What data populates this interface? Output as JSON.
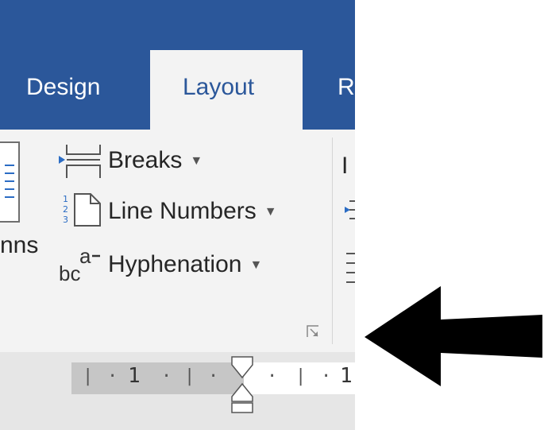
{
  "tabs": {
    "design": "Design",
    "layout": "Layout",
    "next_partial": "R"
  },
  "ribbon": {
    "columns_partial": "nns",
    "breaks": "Breaks",
    "line_numbers": "Line Numbers",
    "hyphenation": "Hyphenation",
    "indent_partial": "I",
    "dropdown_caret": "▼"
  },
  "ruler": {
    "mark_left": "1",
    "mark_right": "1"
  },
  "colors": {
    "tabbar": "#2b579a",
    "ribbon": "#f3f3f3",
    "arrow": "#000000"
  },
  "icons": [
    "breaks-icon",
    "line-numbers-icon",
    "hyphenation-icon",
    "dialog-launcher-icon",
    "ruler-indent-marker-icon",
    "black-arrow-annotation"
  ]
}
